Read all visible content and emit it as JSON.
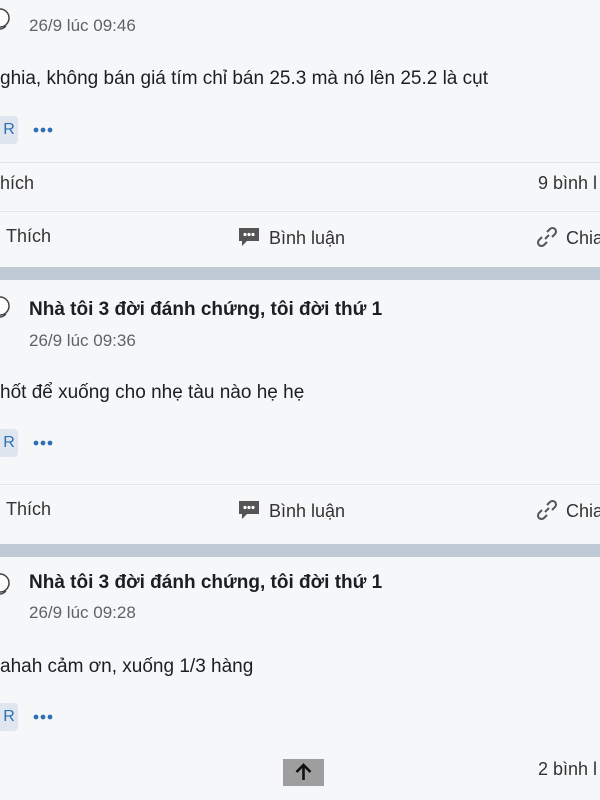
{
  "posts": [
    {
      "timestamp": "26/9 lúc 09:46",
      "text": "ghia, không bán giá tím chỉ bán 25.3 mà nó lên 25.2 là cụt",
      "badge": "R",
      "likes_label": "hích",
      "comments_label": "9 bình l",
      "actions": {
        "like": "Thích",
        "comment": "Bình luận",
        "share": "Chia"
      }
    },
    {
      "author": "Nhà tôi 3 đời đánh chứng, tôi đời thứ 1",
      "timestamp": "26/9 lúc 09:36",
      "text": "hốt để xuống cho nhẹ tàu nào hẹ hẹ",
      "badge": "R",
      "actions": {
        "like": "Thích",
        "comment": "Bình luận",
        "share": "Chia"
      }
    },
    {
      "author": "Nhà tôi 3 đời đánh chứng, tôi đời thứ 1",
      "timestamp": "26/9 lúc 09:28",
      "text": "ahah cảm ơn, xuống 1/3 hàng",
      "badge": "R",
      "comments_label": "2 bình l"
    }
  ],
  "icons": {
    "avatar": "chef-hat-avatar-icon",
    "more": "more-dots-icon",
    "comment": "speech-bubble-icon",
    "share": "link-icon",
    "scroll_top": "arrow-up-icon"
  },
  "colors": {
    "accent": "#2e6fb6",
    "separator": "#bfc9d3",
    "card": "#f6f7f9"
  }
}
